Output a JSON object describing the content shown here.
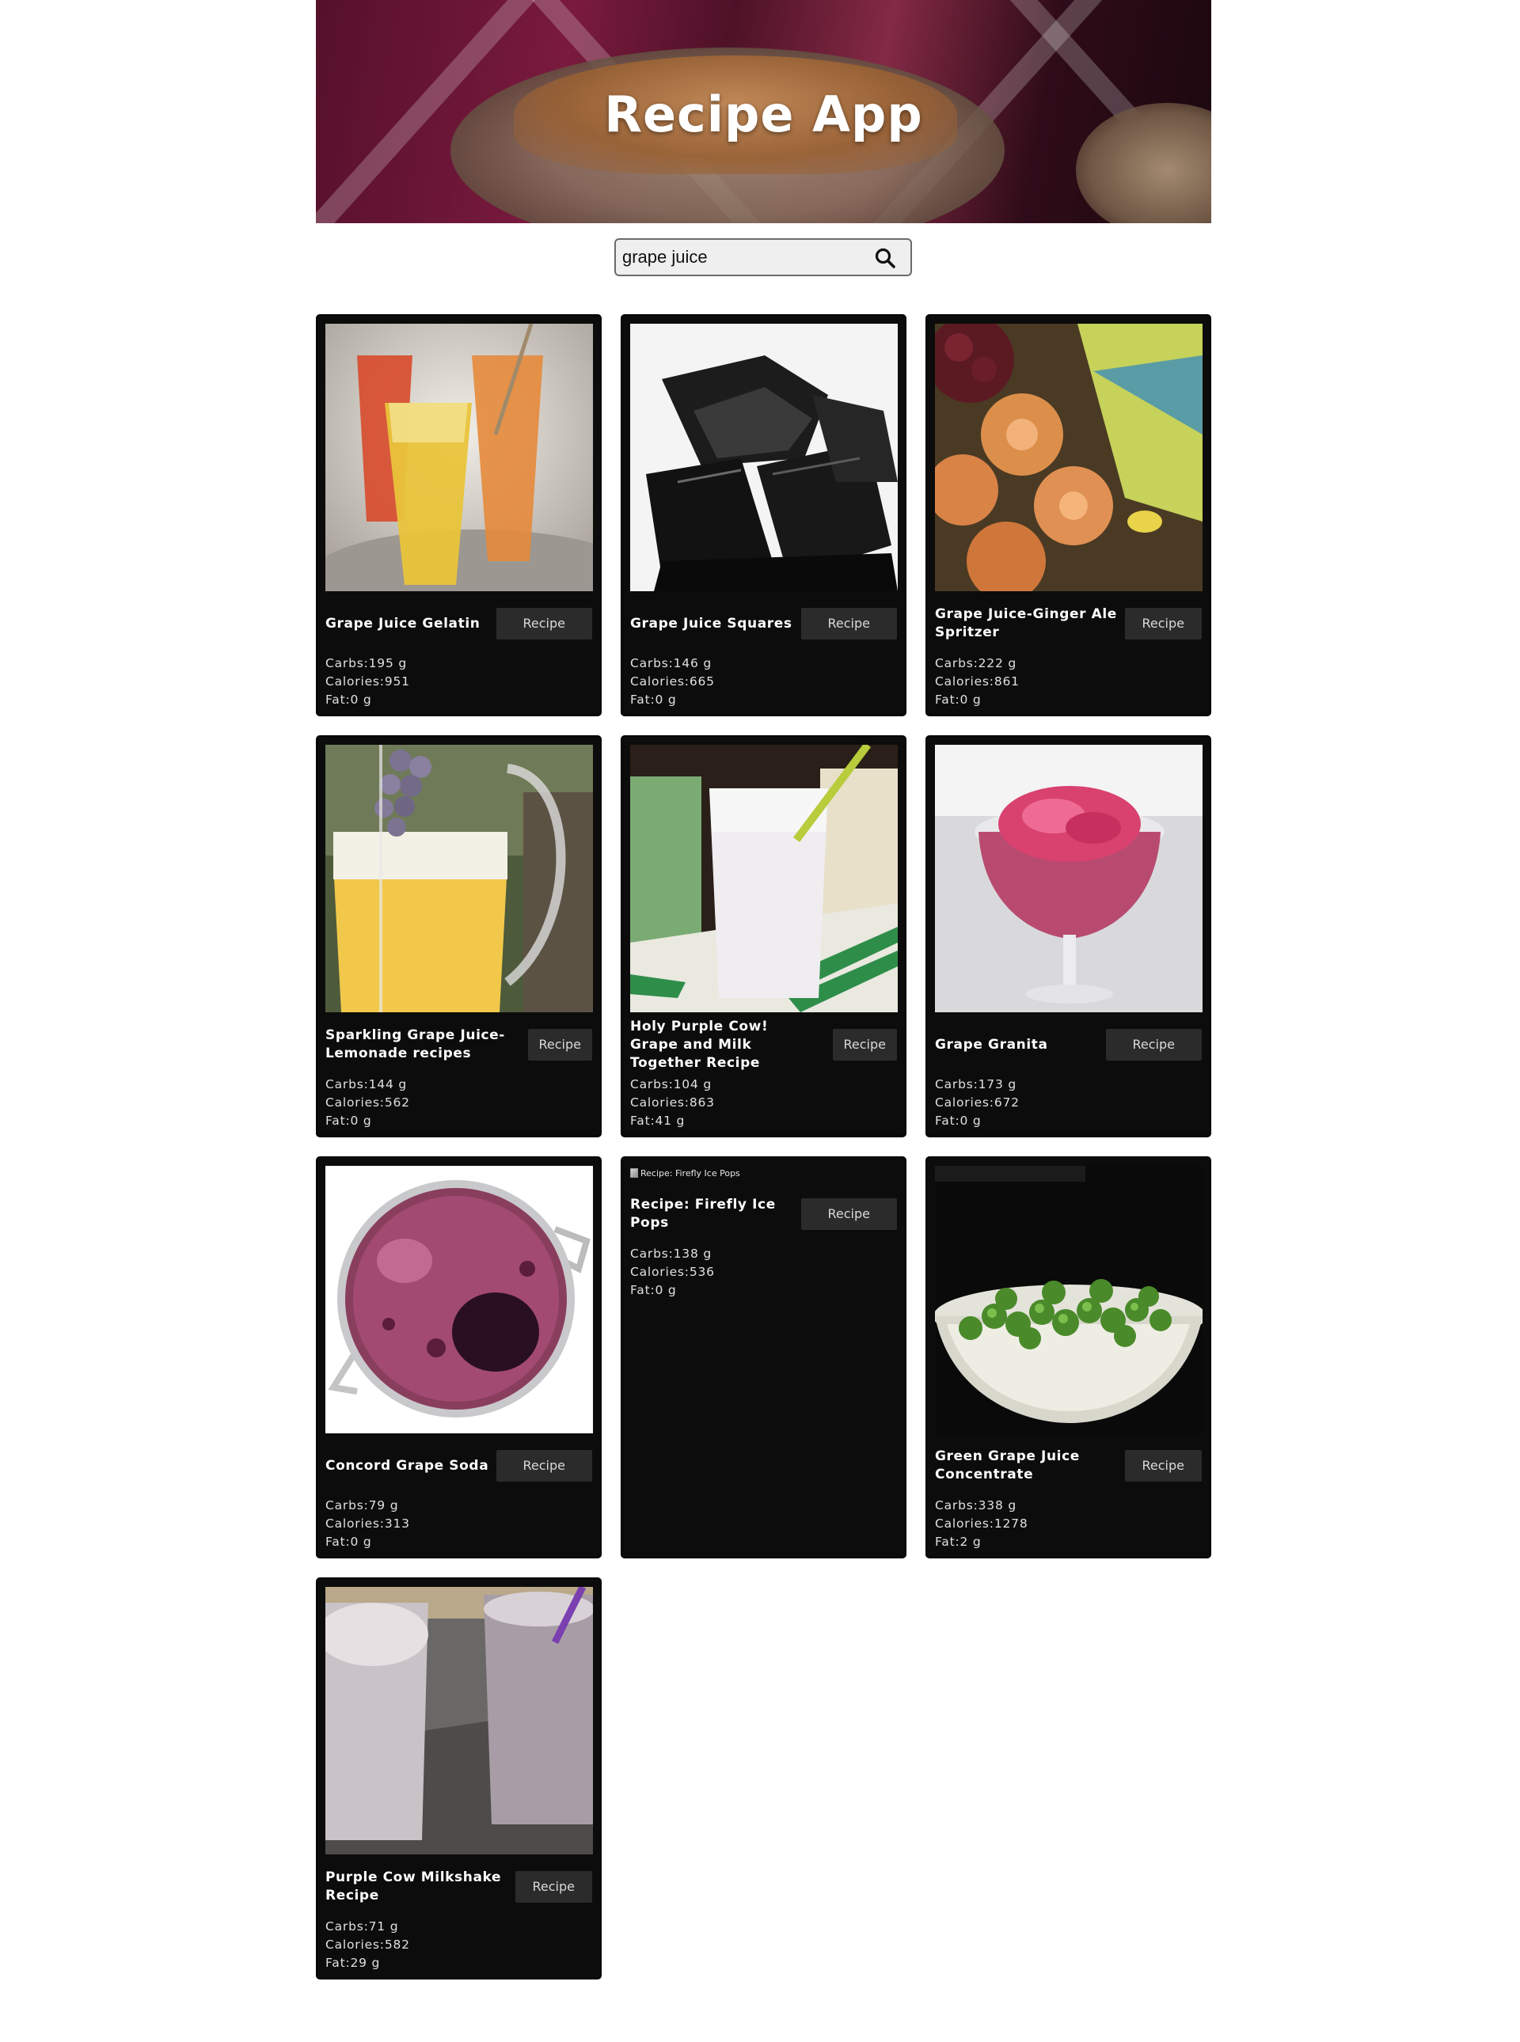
{
  "app": {
    "title": "Recipe App"
  },
  "search": {
    "value": "grape juice",
    "button_label": "Search"
  },
  "recipes": [
    {
      "title": "Grape Juice Gelatin",
      "button": "Recipe",
      "carbs_label": "Carbs:",
      "carbs": "195 g",
      "calories_label": "Calories:",
      "calories": "951",
      "fat_label": "Fat:",
      "fat": "0 g"
    },
    {
      "title": "Grape Juice Squares",
      "button": "Recipe",
      "carbs_label": "Carbs:",
      "carbs": "146 g",
      "calories_label": "Calories:",
      "calories": "665",
      "fat_label": "Fat:",
      "fat": "0 g"
    },
    {
      "title": "Grape Juice-Ginger Ale Spritzer",
      "button": "Recipe",
      "carbs_label": "Carbs:",
      "carbs": "222 g",
      "calories_label": "Calories:",
      "calories": "861",
      "fat_label": "Fat:",
      "fat": "0 g"
    },
    {
      "title": "Sparkling Grape Juice-Lemonade recipes",
      "button": "Recipe",
      "carbs_label": "Carbs:",
      "carbs": "144 g",
      "calories_label": "Calories:",
      "calories": "562",
      "fat_label": "Fat:",
      "fat": "0 g"
    },
    {
      "title": "Holy Purple Cow! Grape and Milk Together Recipe",
      "button": "Recipe",
      "carbs_label": "Carbs:",
      "carbs": "104 g",
      "calories_label": "Calories:",
      "calories": "863",
      "fat_label": "Fat:",
      "fat": "41 g"
    },
    {
      "title": "Grape Granita",
      "button": "Recipe",
      "carbs_label": "Carbs:",
      "carbs": "173 g",
      "calories_label": "Calories:",
      "calories": "672",
      "fat_label": "Fat:",
      "fat": "0 g"
    },
    {
      "title": "Concord Grape Soda",
      "button": "Recipe",
      "carbs_label": "Carbs:",
      "carbs": "79 g",
      "calories_label": "Calories:",
      "calories": "313",
      "fat_label": "Fat:",
      "fat": "0 g"
    },
    {
      "title": "Recipe: Firefly Ice Pops",
      "image_alt": "Recipe: Firefly Ice Pops",
      "button": "Recipe",
      "carbs_label": "Carbs:",
      "carbs": "138 g",
      "calories_label": "Calories:",
      "calories": "536",
      "fat_label": "Fat:",
      "fat": "0 g"
    },
    {
      "title": "Green Grape Juice Concentrate",
      "button": "Recipe",
      "carbs_label": "Carbs:",
      "carbs": "338 g",
      "calories_label": "Calories:",
      "calories": "1278",
      "fat_label": "Fat:",
      "fat": "2 g"
    },
    {
      "title": "Purple Cow Milkshake Recipe",
      "button": "Recipe",
      "carbs_label": "Carbs:",
      "carbs": "71 g",
      "calories_label": "Calories:",
      "calories": "582",
      "fat_label": "Fat:",
      "fat": "29 g"
    }
  ]
}
